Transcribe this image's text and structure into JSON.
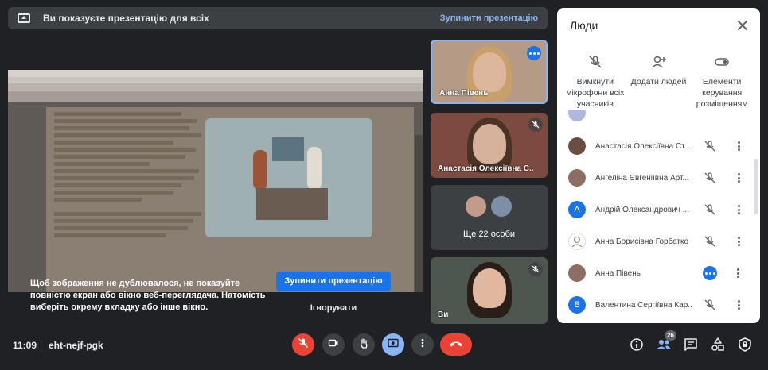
{
  "banner": {
    "text": "Ви показуєте презентацію для всіх",
    "stop_label": "Зупинити презентацію"
  },
  "warning": {
    "message": "Щоб зображення не дублювалося, не показуйте повністю екран або вікно веб-переглядача. Натомість виберіть окрему вкладку або інше вікно.",
    "stop_label": "Зупинити презентацію",
    "ignore_label": "Ігнорувати"
  },
  "tiles": [
    {
      "name": "Анна Півень",
      "state": "speaking"
    },
    {
      "name": "Анастасія Олексіївна С...",
      "state": "muted"
    },
    {
      "more_label": "Ще 22 особи"
    },
    {
      "name": "Ви",
      "state": "muted"
    }
  ],
  "panel": {
    "title": "Люди",
    "actions": [
      {
        "label": "Вимкнути мікрофони всіх учасників",
        "icon": "mic-off-icon"
      },
      {
        "label": "Додати людей",
        "icon": "add-person-icon"
      },
      {
        "label": "Елементи керування розміщенням",
        "icon": "toggle-icon"
      }
    ],
    "people": [
      {
        "name": "Анастасія Олексіївна Ст...",
        "initial": "",
        "avatar_color": "#6d4c41",
        "state": "muted"
      },
      {
        "name": "Ангеліна Євгеніївна Арт...",
        "initial": "",
        "avatar_color": "#8d6e63",
        "state": "muted"
      },
      {
        "name": "Андрій Олександрович ...",
        "initial": "А",
        "avatar_color": "#1a73e8",
        "state": "muted"
      },
      {
        "name": "Анна Борисівна Горбатко",
        "initial": "",
        "avatar_color": "#ffffff",
        "state": "muted"
      },
      {
        "name": "Анна Півень",
        "initial": "",
        "avatar_color": "#8d6e63",
        "state": "speaking"
      },
      {
        "name": "Валентина Сергіївна Кар...",
        "initial": "В",
        "avatar_color": "#1a73e8",
        "state": "muted"
      }
    ]
  },
  "bottom": {
    "time": "11:09",
    "meeting_code": "eht-nejf-pgk",
    "people_count": "26"
  },
  "colors": {
    "background": "#202124",
    "accent": "#8ab4f8",
    "primary_button": "#1a73e8",
    "danger": "#ea4335"
  }
}
